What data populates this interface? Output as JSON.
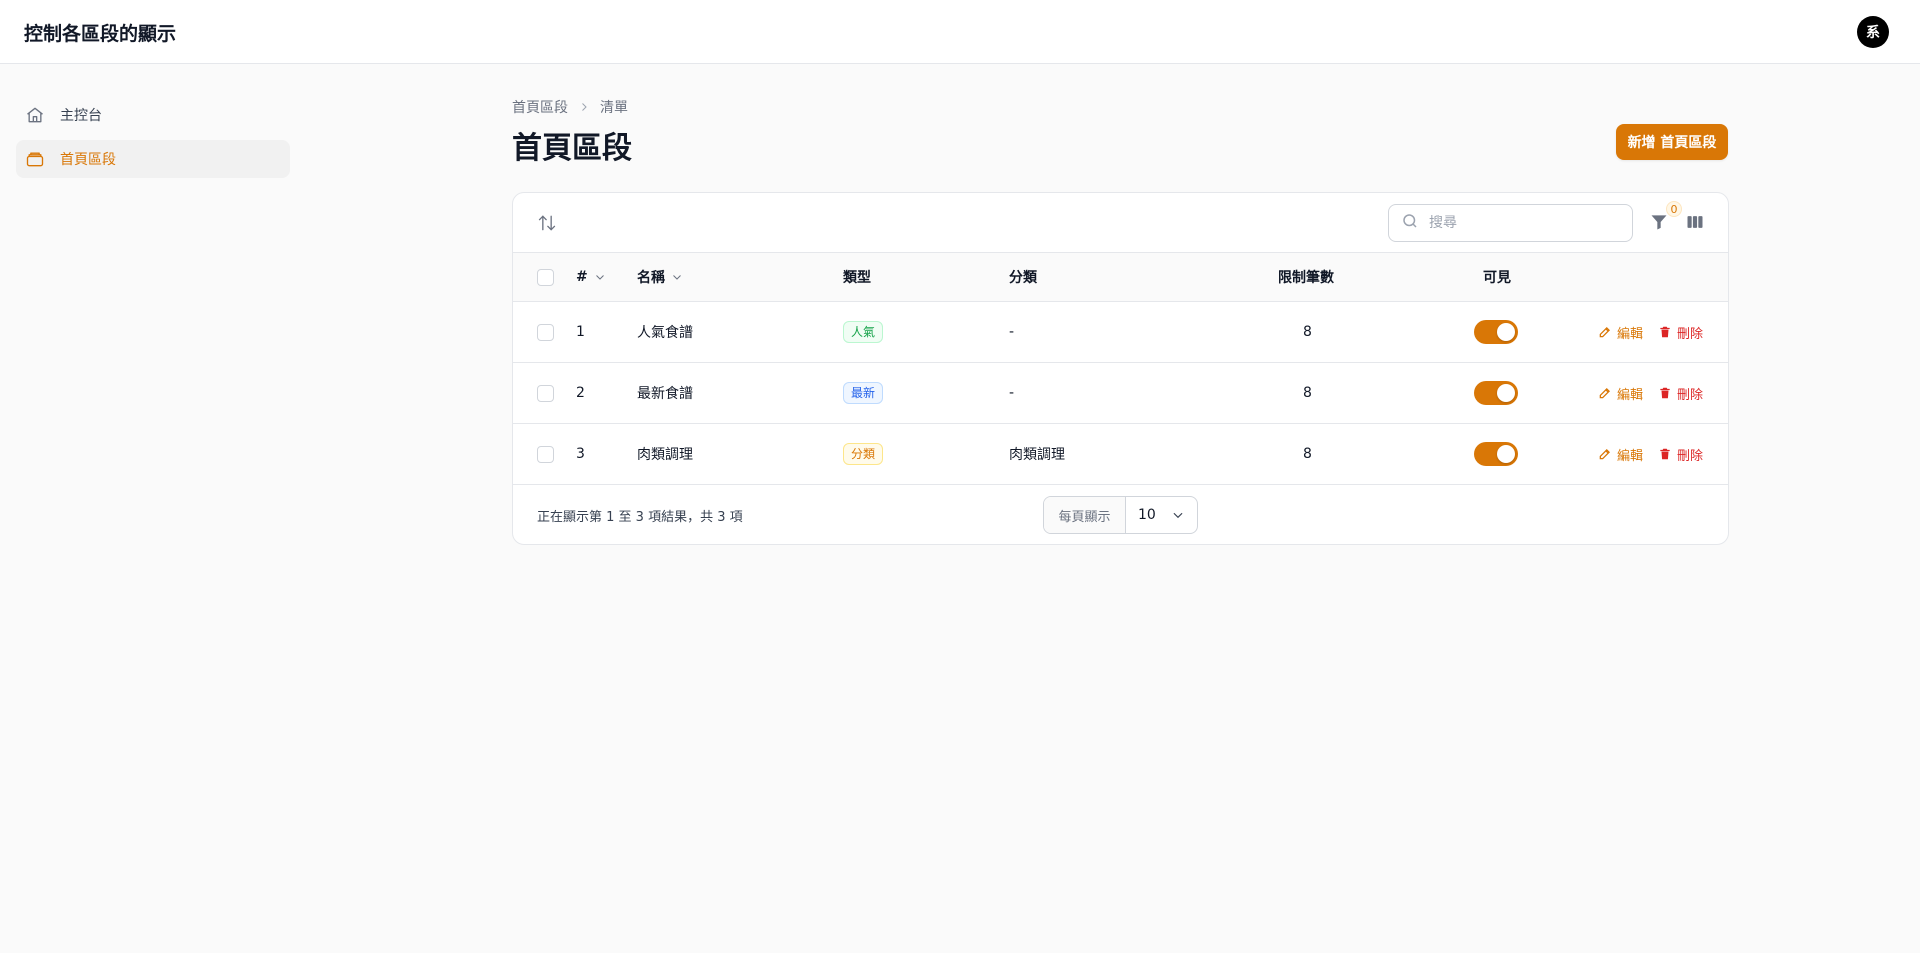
{
  "app": {
    "title": "控制各區段的顯示",
    "avatar_initial": "系"
  },
  "sidebar": {
    "items": [
      {
        "label": "主控台",
        "icon": "home-icon",
        "active": false
      },
      {
        "label": "首頁區段",
        "icon": "stack-icon",
        "active": true
      }
    ]
  },
  "breadcrumb": {
    "root": "首頁區段",
    "current": "清單"
  },
  "page": {
    "title": "首頁區段",
    "new_button": "新增 首頁區段"
  },
  "toolbar": {
    "search_placeholder": "搜尋",
    "filter_count": "0"
  },
  "table": {
    "headers": {
      "index": "#",
      "name": "名稱",
      "type": "類型",
      "category": "分類",
      "limit": "限制筆數",
      "visible": "可見"
    },
    "rows": [
      {
        "index": "1",
        "name": "人氣食譜",
        "type": "人氣",
        "type_color": "green",
        "category": "-",
        "limit": "8",
        "visible": true,
        "edit": "編輯",
        "delete": "刪除"
      },
      {
        "index": "2",
        "name": "最新食譜",
        "type": "最新",
        "type_color": "blue",
        "category": "-",
        "limit": "8",
        "visible": true,
        "edit": "編輯",
        "delete": "刪除"
      },
      {
        "index": "3",
        "name": "肉類調理",
        "type": "分類",
        "type_color": "amber",
        "category": "肉類調理",
        "limit": "8",
        "visible": true,
        "edit": "編輯",
        "delete": "刪除"
      }
    ]
  },
  "footer": {
    "summary": "正在顯示第 1 至 3 項結果，共 3 項",
    "per_page_label": "每頁顯示",
    "per_page_value": "10"
  },
  "colors": {
    "accent": "#d97706",
    "danger": "#dc2626"
  }
}
